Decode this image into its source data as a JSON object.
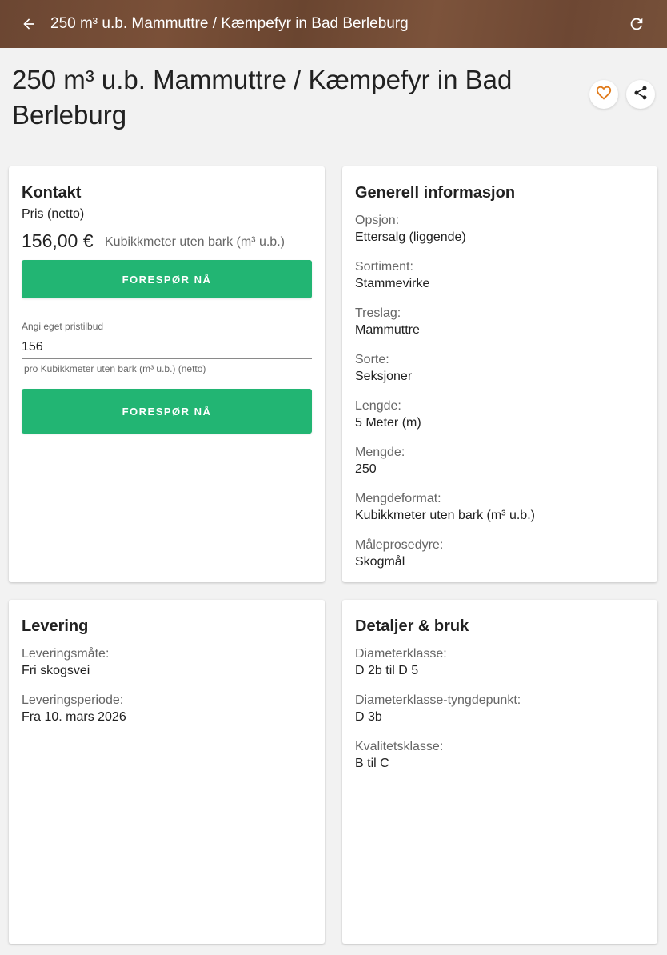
{
  "topbar": {
    "title": "250 m³ u.b. Mammuttre / Kæmpefyr in Bad Berleburg"
  },
  "page": {
    "title": "250 m³ u.b. Mammuttre / Kæmpefyr in Bad Berleburg"
  },
  "kontakt": {
    "heading": "Kontakt",
    "price_label": "Pris (netto)",
    "price": "156,00 €",
    "price_unit": "Kubikkmeter uten bark (m³ u.b.)",
    "button1": "FORESPØR NÅ",
    "offer_label": "Angi eget pristilbud",
    "offer_value": "156",
    "offer_hint": "pro Kubikkmeter uten bark (m³ u.b.) (netto)",
    "button2": "FORESPØR NÅ"
  },
  "generell": {
    "heading": "Generell informasjon",
    "items": [
      {
        "key": "Opsjon:",
        "value": "Ettersalg (liggende)"
      },
      {
        "key": "Sortiment:",
        "value": "Stammevirke"
      },
      {
        "key": "Treslag:",
        "value": "Mammuttre"
      },
      {
        "key": "Sorte:",
        "value": "Seksjoner"
      },
      {
        "key": "Lengde:",
        "value": "5 Meter (m)"
      },
      {
        "key": "Mengde:",
        "value": "250"
      },
      {
        "key": "Mengdeformat:",
        "value": "Kubikkmeter uten bark (m³ u.b.)"
      },
      {
        "key": "Måleprosedyre:",
        "value": "Skogmål"
      }
    ]
  },
  "levering": {
    "heading": "Levering",
    "items": [
      {
        "key": "Leveringsmåte:",
        "value": "Fri skogsvei"
      },
      {
        "key": "Leveringsperiode:",
        "value": "Fra 10. mars 2026"
      }
    ]
  },
  "detaljer": {
    "heading": "Detaljer & bruk",
    "items": [
      {
        "key": "Diameterklasse:",
        "value": "D 2b til D 5"
      },
      {
        "key": "Diameterklasse-tyngdepunkt:",
        "value": "D 3b"
      },
      {
        "key": "Kvalitetsklasse:",
        "value": "B til C"
      }
    ]
  },
  "colors": {
    "accent_green": "#22b573",
    "header_brown": "#6b4632",
    "favorite_orange": "#e07a1a"
  },
  "icons": {
    "back": "arrow-left-icon",
    "refresh": "refresh-icon",
    "favorite": "heart-outline-icon",
    "share": "share-icon"
  }
}
